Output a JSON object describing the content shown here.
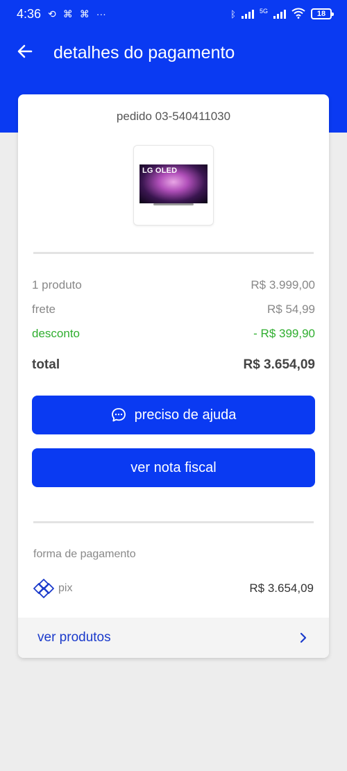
{
  "status_bar": {
    "time": "4:36",
    "network": "5G",
    "battery": "18"
  },
  "header": {
    "title": "detalhes do pagamento"
  },
  "order": {
    "id_label": "pedido 03-540411030",
    "product_image_text": "LG OLED"
  },
  "summary": {
    "products_label": "1 produto",
    "products_value": "R$ 3.999,00",
    "shipping_label": "frete",
    "shipping_value": "R$ 54,99",
    "discount_label": "desconto",
    "discount_value": "- R$ 399,90",
    "total_label": "total",
    "total_value": "R$ 3.654,09"
  },
  "actions": {
    "help_label": "preciso de ajuda",
    "invoice_label": "ver nota fiscal"
  },
  "payment": {
    "section_label": "forma de pagamento",
    "method_label": "pix",
    "method_value": "R$ 3.654,09"
  },
  "footer": {
    "link_label": "ver produtos"
  },
  "colors": {
    "brand": "#0a3af2",
    "discount": "#2fae2f",
    "link": "#1a3acb"
  },
  "icons": {
    "back": "arrow-left-icon",
    "help": "chat-bubble-icon",
    "pix": "pix-icon",
    "chevron": "chevron-right-icon"
  }
}
